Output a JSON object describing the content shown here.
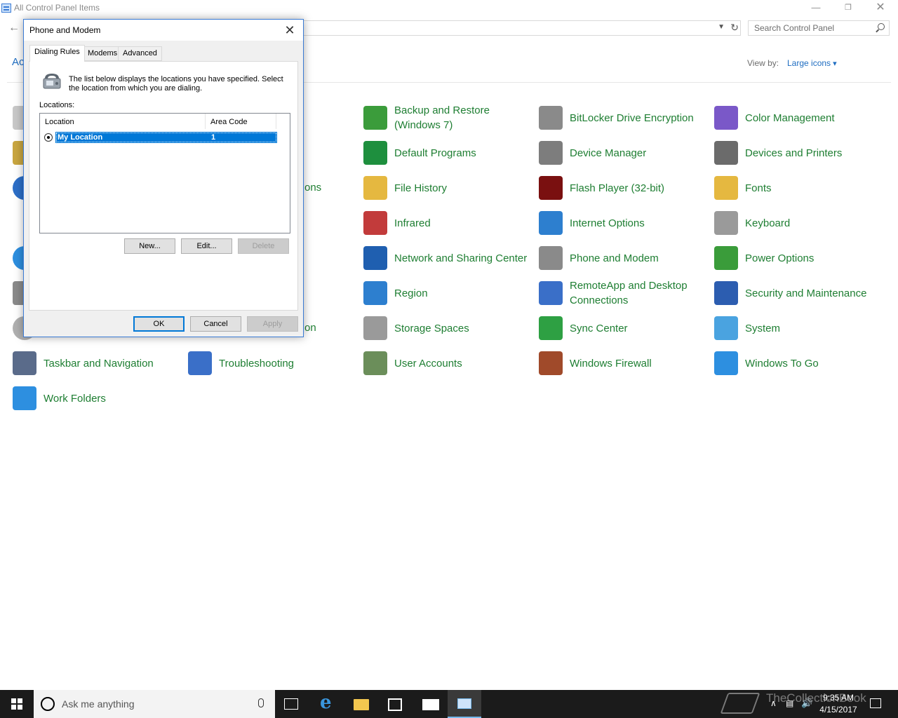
{
  "control_panel": {
    "title": "All Control Panel Items",
    "search_placeholder": "Search Control Panel",
    "adjust_partial": "Ac",
    "view_by_label": "View by:",
    "view_by_value": "Large icons",
    "partial_labels": [
      "ons",
      "on"
    ],
    "items": [
      {
        "label": "Backup and Restore (Windows 7)",
        "icon": "backup-icon",
        "color": "#3b9c3b"
      },
      {
        "label": "BitLocker Drive Encryption",
        "icon": "bitlocker-icon",
        "color": "#8a8a8a"
      },
      {
        "label": "Color Management",
        "icon": "color-management-icon",
        "color": "#7a58c8"
      },
      {
        "label": "Default Programs",
        "icon": "default-programs-icon",
        "color": "#1e8f3e"
      },
      {
        "label": "Device Manager",
        "icon": "device-manager-icon",
        "color": "#7d7d7d"
      },
      {
        "label": "Devices and Printers",
        "icon": "printer-icon",
        "color": "#6b6b6b"
      },
      {
        "label": "File History",
        "icon": "file-history-icon",
        "color": "#e5b840"
      },
      {
        "label": "Flash Player (32-bit)",
        "icon": "flash-icon",
        "color": "#7a1010"
      },
      {
        "label": "Fonts",
        "icon": "fonts-icon",
        "color": "#e5b840"
      },
      {
        "label": "Infrared",
        "icon": "infrared-icon",
        "color": "#c23b3b"
      },
      {
        "label": "Internet Options",
        "icon": "internet-options-icon",
        "color": "#2d7fcf"
      },
      {
        "label": "Keyboard",
        "icon": "keyboard-icon",
        "color": "#9a9a9a"
      },
      {
        "label": "Network and Sharing Center",
        "icon": "network-icon",
        "color": "#1f5fb0"
      },
      {
        "label": "Phone and Modem",
        "icon": "phone-icon",
        "color": "#8a8a8a"
      },
      {
        "label": "Power Options",
        "icon": "power-options-icon",
        "color": "#3a9c3a"
      },
      {
        "label": "Region",
        "icon": "region-icon",
        "color": "#2d7fcf"
      },
      {
        "label": "RemoteApp and Desktop Connections",
        "icon": "remoteapp-icon",
        "color": "#3a6fc8"
      },
      {
        "label": "Security and Maintenance",
        "icon": "flag-icon",
        "color": "#2c5db0"
      },
      {
        "label": "Storage Spaces",
        "icon": "storage-spaces-icon",
        "color": "#9a9a9a"
      },
      {
        "label": "Sync Center",
        "icon": "sync-center-icon",
        "color": "#2ea043"
      },
      {
        "label": "System",
        "icon": "system-icon",
        "color": "#4aa3e0"
      },
      {
        "label": "Taskbar and Navigation",
        "icon": "taskbar-icon",
        "color": "#5a6b8a"
      },
      {
        "label": "Troubleshooting",
        "icon": "troubleshooting-icon",
        "color": "#3a6fc8"
      },
      {
        "label": "User Accounts",
        "icon": "user-accounts-icon",
        "color": "#6b8e5a"
      },
      {
        "label": "Windows Firewall",
        "icon": "firewall-icon",
        "color": "#a04a2a"
      },
      {
        "label": "Windows To Go",
        "icon": "windows-to-go-icon",
        "color": "#2d8fe0"
      },
      {
        "label": "Work Folders",
        "icon": "work-folders-icon",
        "color": "#2d8fe0"
      }
    ]
  },
  "dialog": {
    "title": "Phone and Modem",
    "tabs": [
      "Dialing Rules",
      "Modems",
      "Advanced"
    ],
    "intro": "The list below displays the locations you have specified. Select the location from which you are dialing.",
    "locations_label": "Locations:",
    "columns": [
      "Location",
      "Area Code"
    ],
    "rows": [
      {
        "location": "My Location",
        "area_code": "1"
      }
    ],
    "buttons": {
      "new": "New...",
      "edit": "Edit...",
      "delete": "Delete",
      "ok": "OK",
      "cancel": "Cancel",
      "apply": "Apply"
    }
  },
  "taskbar": {
    "search_placeholder": "Ask me anything",
    "time": "9:35 AM",
    "date": "4/15/2017",
    "watermark": "TheCollectionBook"
  }
}
